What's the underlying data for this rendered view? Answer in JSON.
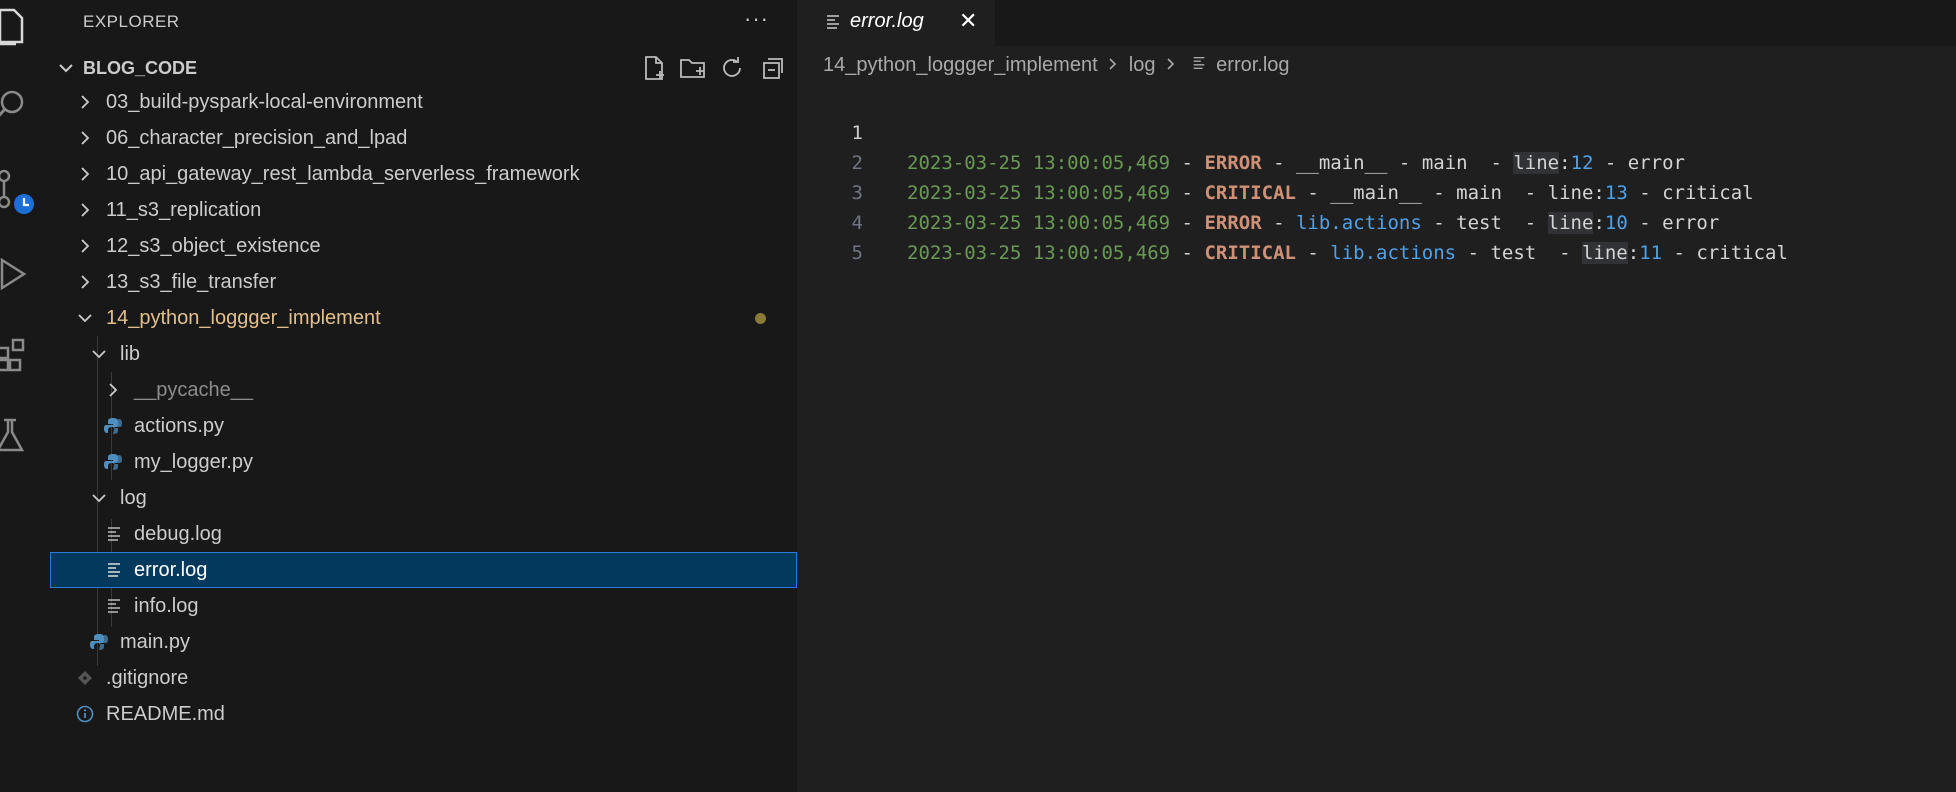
{
  "sidebar": {
    "title": "EXPLORER",
    "more_label": "···",
    "section_label": "BLOG_CODE",
    "tree": [
      {
        "label": "03_build-pyspark-local-environment"
      },
      {
        "label": "06_character_precision_and_lpad"
      },
      {
        "label": "10_api_gateway_rest_lambda_serverless_framework"
      },
      {
        "label": "11_s3_replication"
      },
      {
        "label": "12_s3_object_existence"
      },
      {
        "label": "13_s3_file_transfer"
      },
      {
        "label": "14_python_loggger_implement"
      },
      {
        "label": "lib"
      },
      {
        "label": "__pycache__"
      },
      {
        "label": "actions.py"
      },
      {
        "label": "my_logger.py"
      },
      {
        "label": "log"
      },
      {
        "label": "debug.log"
      },
      {
        "label": "error.log"
      },
      {
        "label": "info.log"
      },
      {
        "label": "main.py"
      },
      {
        "label": ".gitignore"
      },
      {
        "label": "README.md"
      }
    ]
  },
  "editor": {
    "tab_label": "error.log",
    "tab_close": "✕",
    "breadcrumbs": [
      "14_python_loggger_implement",
      "log",
      "error.log"
    ],
    "lines": [
      {
        "num": "1",
        "ts": "2023-03-25 13:00:05,469",
        "level": "ERROR",
        "module": "__main__",
        "func": "main",
        "line_no": "12",
        "msg": "error"
      },
      {
        "num": "2",
        "ts": "2023-03-25 13:00:05,469",
        "level": "CRITICAL",
        "module": "__main__",
        "func": "main",
        "line_no": "13",
        "msg": "critical"
      },
      {
        "num": "3",
        "ts": "2023-03-25 13:00:05,469",
        "level": "ERROR",
        "module": "lib.actions",
        "func": "test",
        "line_no": "10",
        "msg": "error"
      },
      {
        "num": "4",
        "ts": "2023-03-25 13:00:05,469",
        "level": "CRITICAL",
        "module": "lib.actions",
        "func": "test",
        "line_no": "11",
        "msg": "critical"
      },
      {
        "num": "5"
      }
    ],
    "sep": " - ",
    "line_kw": "line",
    "colon": ":"
  },
  "colors": {
    "accent": "#2b79d7",
    "selected_bg": "#04395e",
    "modified": "#e2c08d",
    "timestamp": "#6a9955",
    "level": "#ce9178",
    "module": "#4fa1e8"
  },
  "icons": [
    "files-icon",
    "search-icon",
    "source-control-icon",
    "run-debug-icon",
    "extensions-icon",
    "testing-icon",
    "new-file-icon",
    "new-folder-icon",
    "refresh-icon",
    "collapse-all-icon",
    "chevron-right-icon",
    "chevron-down-icon",
    "python-file-icon",
    "log-file-icon",
    "git-file-icon",
    "info-file-icon"
  ]
}
